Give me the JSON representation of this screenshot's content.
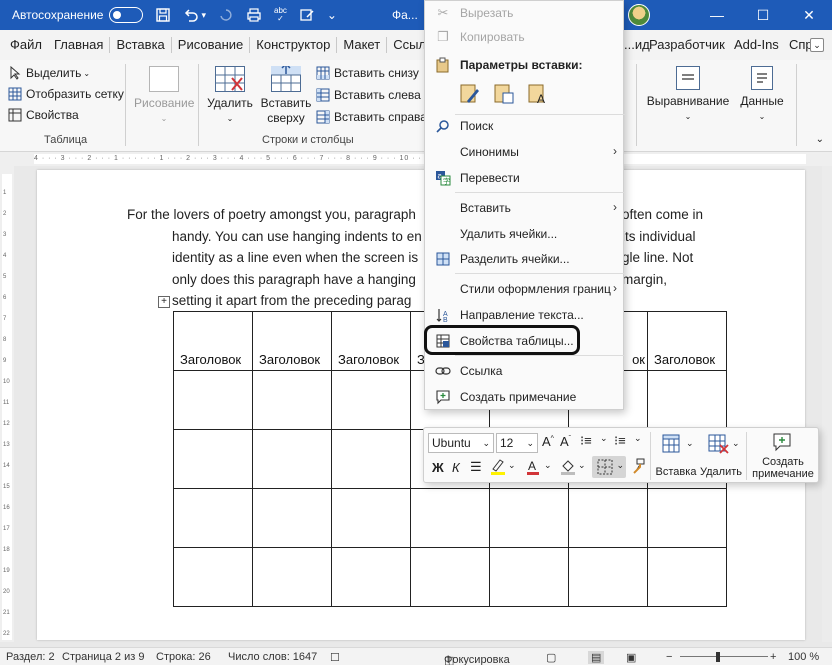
{
  "titlebar": {
    "autosave_label": "Автосохранение",
    "doc_title": "Фа...",
    "minimize": "—",
    "maximize": "☐",
    "close": "✕",
    "abc_label": "abc"
  },
  "tabs": [
    "Файл",
    "Главная",
    "Вставка",
    "Рисование",
    "Конструктор",
    "Макет",
    "Ссылки"
  ],
  "tabs_right": [
    "...ид",
    "Разработчик",
    "Add-Ins",
    "Спр"
  ],
  "ribbon": {
    "select_label": "Выделить",
    "gridlines_label": "Отобразить сетку",
    "properties_label": "Свойства",
    "group_table": "Таблица",
    "draw_label": "Рисование",
    "delete_label": "Удалить",
    "insert_above_label": "Вставить сверху",
    "insert_below_label": "Вставить снизу",
    "insert_left_label": "Вставить слева",
    "insert_right_label": "Вставить справа",
    "group_rows_cols": "Строки и столбцы",
    "alignment_label": "Выравнивание",
    "data_label": "Данные"
  },
  "ruler": {
    "h_text": "4 · · · 3 · · · 2 · · · 1 · · · · · · 1 · · · 2 · · · 3 · · · 4 · · · 5 · · · 6 · · · 7 · · · 8 · · · 9 · · · 10 · · 11 · · 12 · · 13 · · 14 · · 15 · · 16 · · 17 · ·",
    "v_marks": [
      "1",
      "2",
      "3",
      "4",
      "5",
      "6",
      "7",
      "8",
      "9",
      "10",
      "11",
      "12",
      "13",
      "14",
      "15",
      "16",
      "17",
      "18",
      "19",
      "20",
      "21",
      "22"
    ]
  },
  "document": {
    "lines": [
      "For the lovers of poetry amongst you, paragraph",
      "handy. You can use hanging indents to en",
      "identity as a line even when the screen is",
      "only does this paragraph have a hanging",
      "setting it apart from the preceding parag"
    ],
    "lines_right": [
      "often come in",
      "its individual",
      "gle line. Not",
      "margin,",
      ""
    ],
    "table_header": [
      "Заголовок",
      "Заголовок",
      "Заголовок",
      "З",
      "",
      "ок",
      "Заголовок"
    ]
  },
  "context_menu": {
    "cut": "Вырезать",
    "copy": "Копировать",
    "paste_options": "Параметры вставки:",
    "search": "Поиск",
    "synonyms": "Синонимы",
    "translate": "Перевести",
    "insert": "Вставить",
    "delete_cells": "Удалить ячейки...",
    "split_cells": "Разделить ячейки...",
    "border_styles": "Стили оформления границ",
    "text_direction": "Направление текста...",
    "table_properties": "Свойства таблицы...",
    "link": "Ссылка",
    "new_comment": "Создать примечание"
  },
  "mini_toolbar": {
    "font": "Ubuntu",
    "size": "12",
    "bold": "Ж",
    "italic": "К",
    "insert_label": "Вставка",
    "delete_label": "Удалить",
    "comment_label": "Создать примечание"
  },
  "status": {
    "section": "Раздел: 2",
    "page": "Страница 2 из 9",
    "line": "Строка: 26",
    "words": "Число слов: 1647",
    "focus": "Фокусировка",
    "zoom": "100 %"
  },
  "colors": {
    "titlebar": "#1e5bb8",
    "accent": "#2b579a",
    "highlight": "#fff200",
    "font_color": "#d13438"
  }
}
